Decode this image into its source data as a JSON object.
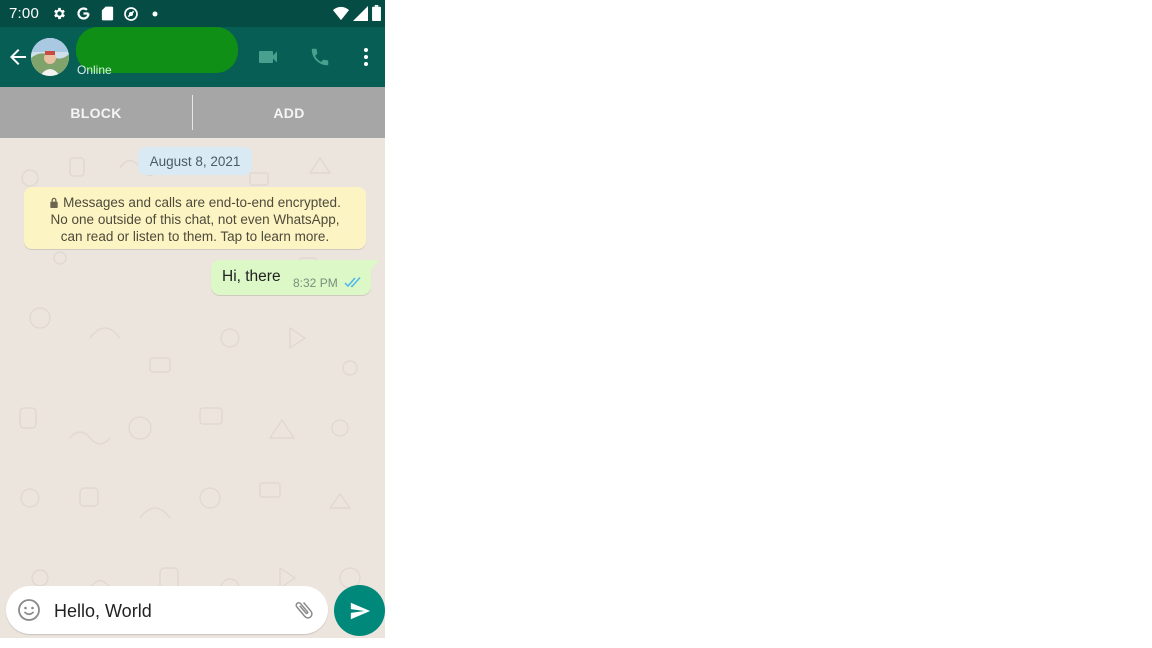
{
  "status_bar": {
    "time": "7:00",
    "left_icons": [
      "settings-icon",
      "google-icon",
      "sd-card-icon",
      "at-sign-icon",
      "dot-icon"
    ],
    "right_icons": [
      "wifi-icon",
      "signal-icon",
      "battery-icon"
    ]
  },
  "header": {
    "contact_status": "Online",
    "actions": [
      "video-call-icon",
      "voice-call-icon",
      "more-vert-icon"
    ],
    "colors": {
      "app_bar": "#075e54",
      "status_bar": "#054d44",
      "redaction": "#0f8f16"
    }
  },
  "action_bar": {
    "block_label": "BLOCK",
    "add_label": "ADD"
  },
  "chat": {
    "date_chip": "August 8, 2021",
    "encryption_notice": {
      "line1": "Messages and calls are end-to-end encrypted.",
      "line2": "No one outside of this chat, not even WhatsApp,",
      "line3": "can read or listen to them. Tap to learn more."
    },
    "messages": [
      {
        "text": "Hi, there",
        "time": "8:32 PM",
        "status": "read"
      }
    ]
  },
  "composer": {
    "input_value": "Hello, World",
    "send_color": "#00897b"
  }
}
